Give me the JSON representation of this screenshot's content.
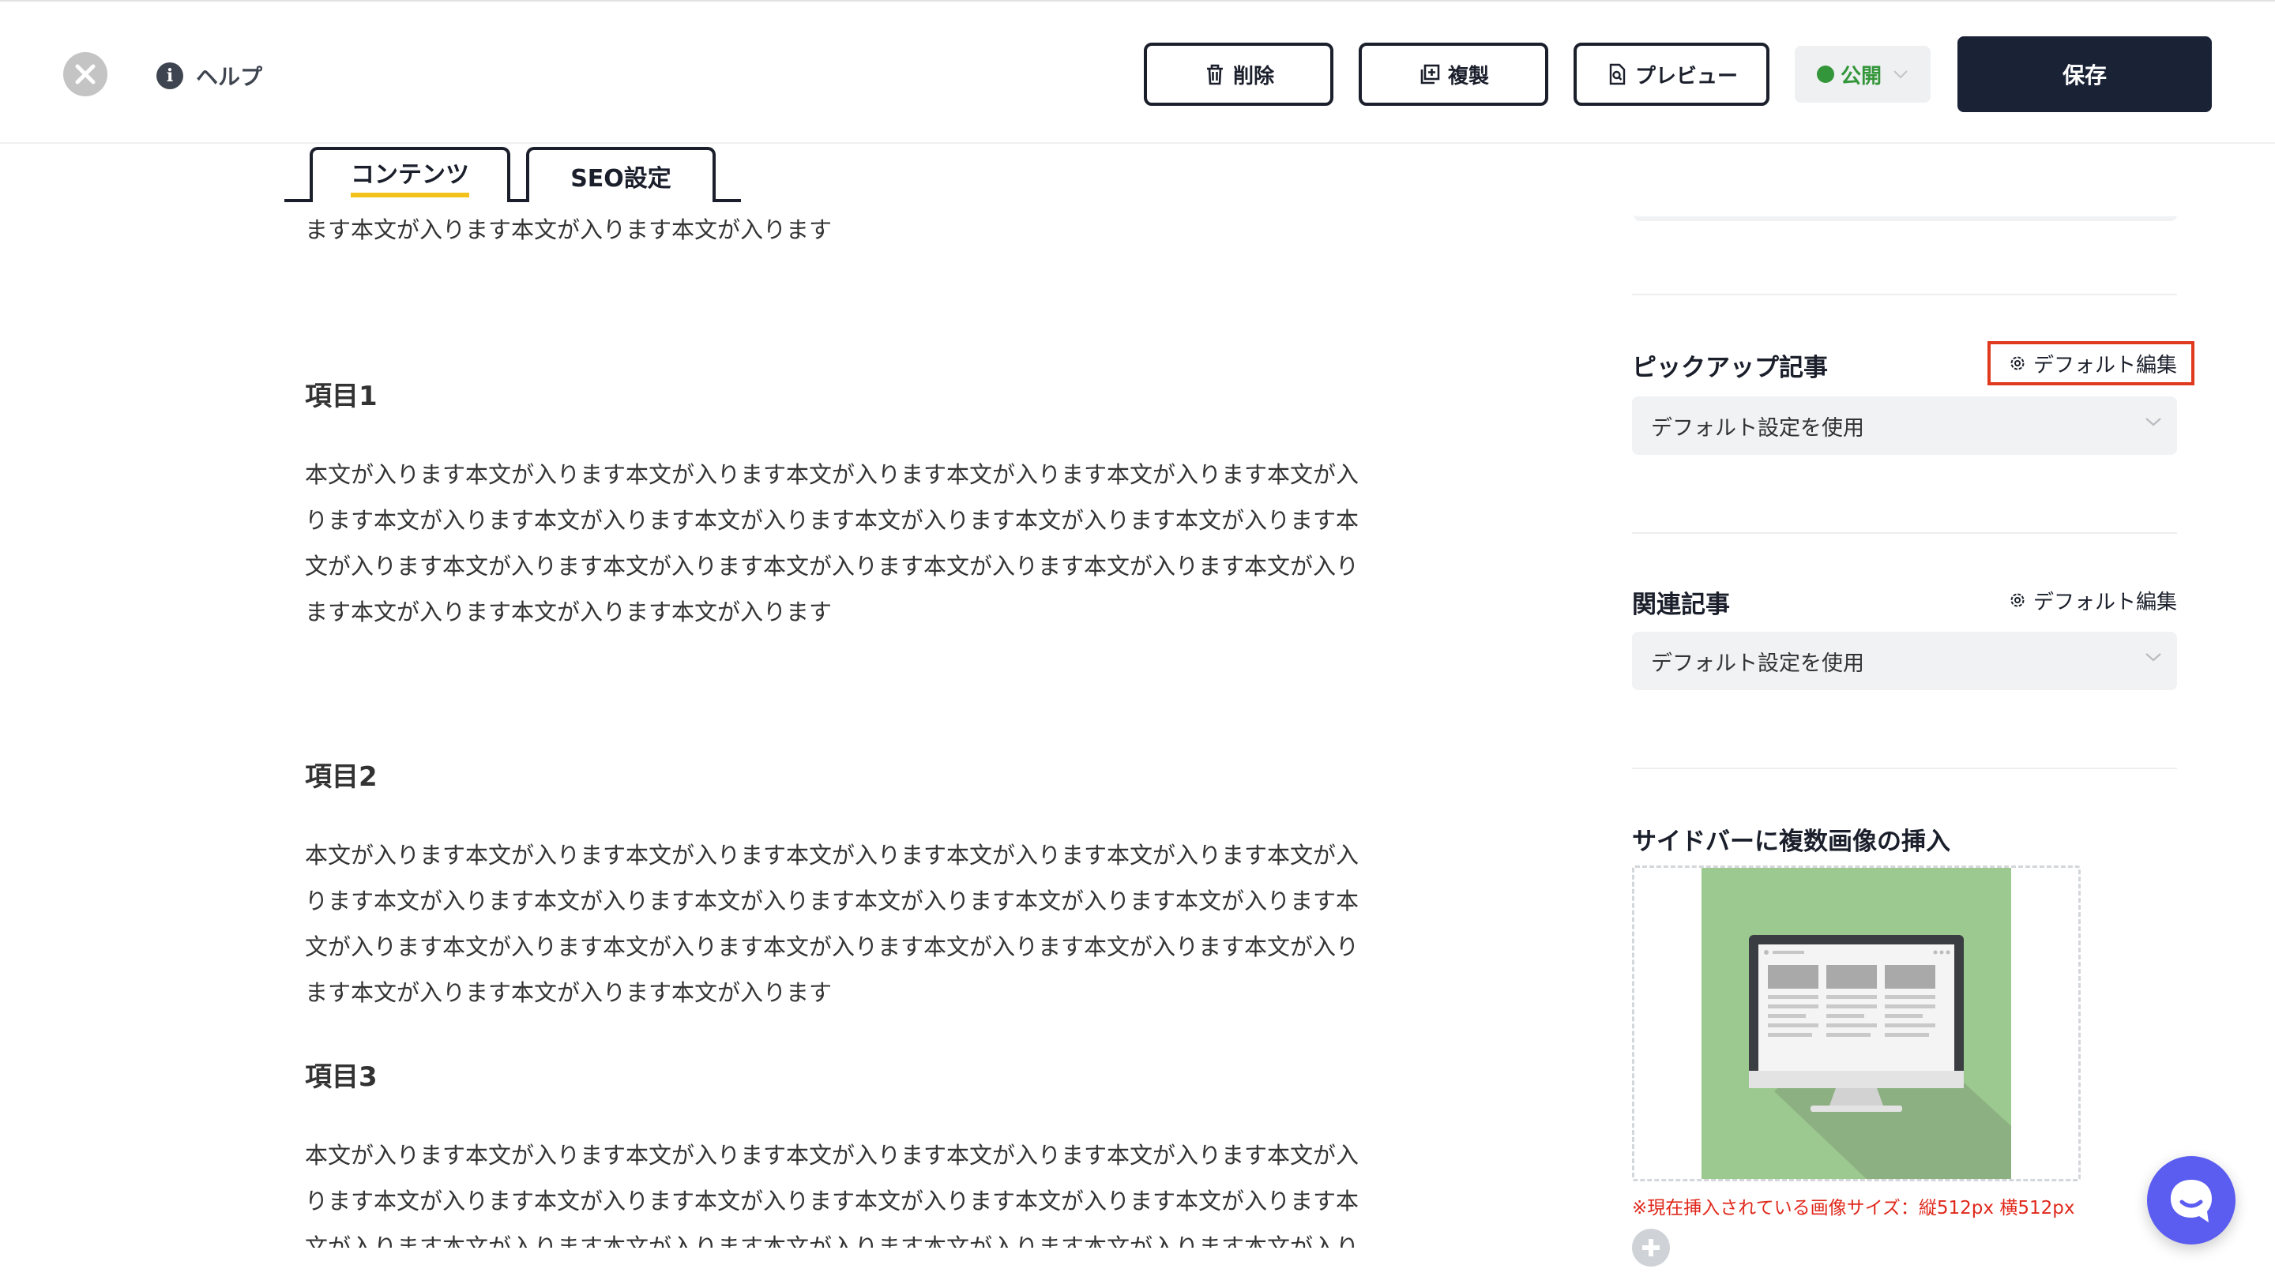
{
  "header": {
    "help_label": "ヘルプ",
    "delete_label": "削除",
    "duplicate_label": "複製",
    "preview_label": "プレビュー",
    "status_label": "公開",
    "save_label": "保存"
  },
  "tabs": [
    {
      "label": "コンテンツ",
      "active": true
    },
    {
      "label": "SEO設定",
      "active": false
    }
  ],
  "content": {
    "intro_tail": "ます本文が入ります本文が入ります本文が入ります",
    "sections": [
      {
        "heading": "項目1",
        "lines": [
          "本文が入ります本文が入ります本文が入ります本文が入ります本文が入ります本文が入ります本文が入",
          "ります本文が入ります本文が入ります本文が入ります本文が入ります本文が入ります本文が入ります本",
          "文が入ります本文が入ります本文が入ります本文が入ります本文が入ります本文が入ります本文が入り",
          "ます本文が入ります本文が入ります本文が入ります"
        ]
      },
      {
        "heading": "項目2",
        "lines": [
          "本文が入ります本文が入ります本文が入ります本文が入ります本文が入ります本文が入ります本文が入",
          "ります本文が入ります本文が入ります本文が入ります本文が入ります本文が入ります本文が入ります本",
          "文が入ります本文が入ります本文が入ります本文が入ります本文が入ります本文が入ります本文が入り",
          "ます本文が入ります本文が入ります本文が入ります"
        ]
      },
      {
        "heading": "項目3",
        "lines": [
          "本文が入ります本文が入ります本文が入ります本文が入ります本文が入ります本文が入ります本文が入",
          "ります本文が入ります本文が入ります本文が入ります本文が入ります本文が入ります本文が入ります本",
          "文が入ります本文が入ります本文が入ります本文が入ります本文が入ります本文が入ります本文が入り"
        ]
      }
    ]
  },
  "sidebar": {
    "pickup": {
      "title": "ピックアップ記事",
      "edit_label": "デフォルト編集",
      "select_value": "デフォルト設定を使用"
    },
    "related": {
      "title": "関連記事",
      "edit_label": "デフォルト編集",
      "select_value": "デフォルト設定を使用"
    },
    "images": {
      "title": "サイドバーに複数画像の挿入",
      "note": "※現在挿入されている画像サイズ：縦512px 横512px"
    }
  },
  "colors": {
    "primary_dark": "#1a2236",
    "status_green": "#34963a",
    "tab_underline": "#f2c21b",
    "highlight_red": "#e03a1e",
    "note_red": "#e0281b",
    "chat_purple": "#5b5cf0",
    "image_green": "#9bc98f"
  },
  "icons": {
    "close": "close-icon",
    "help": "info-icon",
    "delete": "trash-icon",
    "duplicate": "copy-icon",
    "preview": "document-search-icon",
    "settings": "gear-icon",
    "dropdown": "chevron-down-icon",
    "add": "plus-circle-icon",
    "chat": "chat-icon"
  }
}
